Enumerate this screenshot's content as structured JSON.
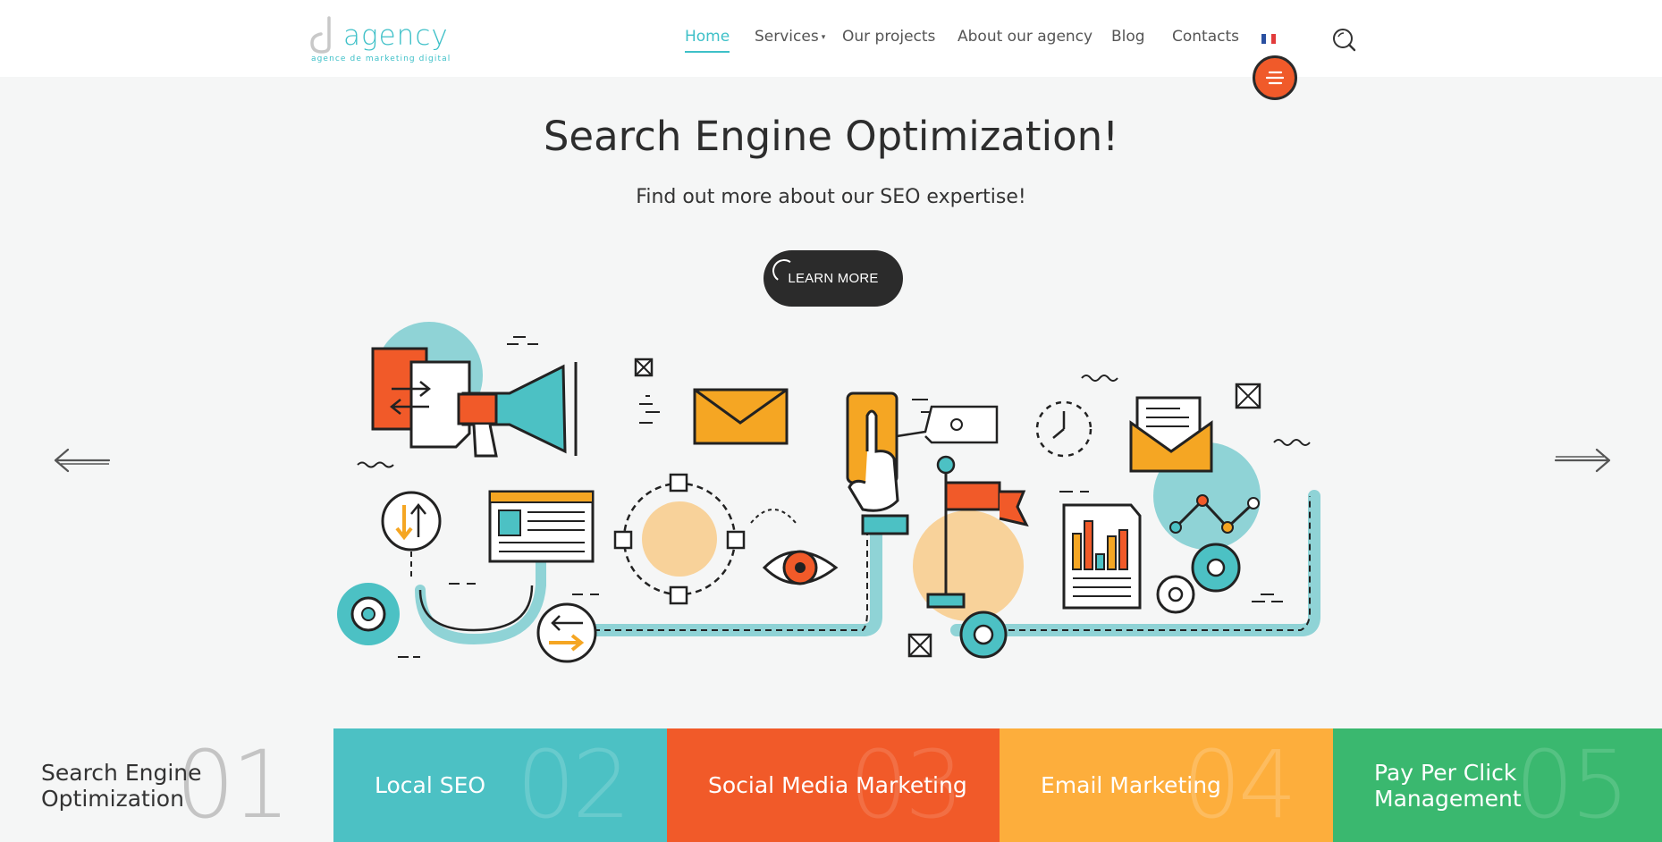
{
  "header": {
    "logo": {
      "wordmark": "agency",
      "tagline": "agence de marketing digital"
    },
    "nav": [
      {
        "label": "Home",
        "active": true
      },
      {
        "label": "Services",
        "has_dropdown": true
      },
      {
        "label": "Our projects"
      },
      {
        "label": "About our agency"
      },
      {
        "label": "Blog"
      },
      {
        "label": "Contacts"
      }
    ],
    "language_icon": "french-flag-icon",
    "search_icon": "search-icon",
    "menu_icon": "hamburger-menu-icon"
  },
  "hero": {
    "title": "Search Engine Optimization!",
    "subtitle": "Find out more about our SEO expertise!",
    "cta_label": "LEARN MORE",
    "prev_icon": "arrow-left-icon",
    "next_icon": "arrow-right-icon",
    "illustration": "seo-marketing-illustration"
  },
  "tabs": [
    {
      "label": "Search Engine\nOptimization",
      "number": "01",
      "color": "#f5f6f6",
      "active": true
    },
    {
      "label": "Local SEO",
      "number": "02",
      "color": "#4cc1c4"
    },
    {
      "label": "Social Media Marketing",
      "number": "03",
      "color": "#f15a29"
    },
    {
      "label": "Email Marketing",
      "number": "04",
      "color": "#fdae3c"
    },
    {
      "label": "Pay Per Click\nManagement",
      "number": "05",
      "color": "#3ab86f"
    }
  ],
  "colors": {
    "accent": "#3ec0c8",
    "orange": "#f15a29",
    "dark": "#2b2b2b"
  }
}
